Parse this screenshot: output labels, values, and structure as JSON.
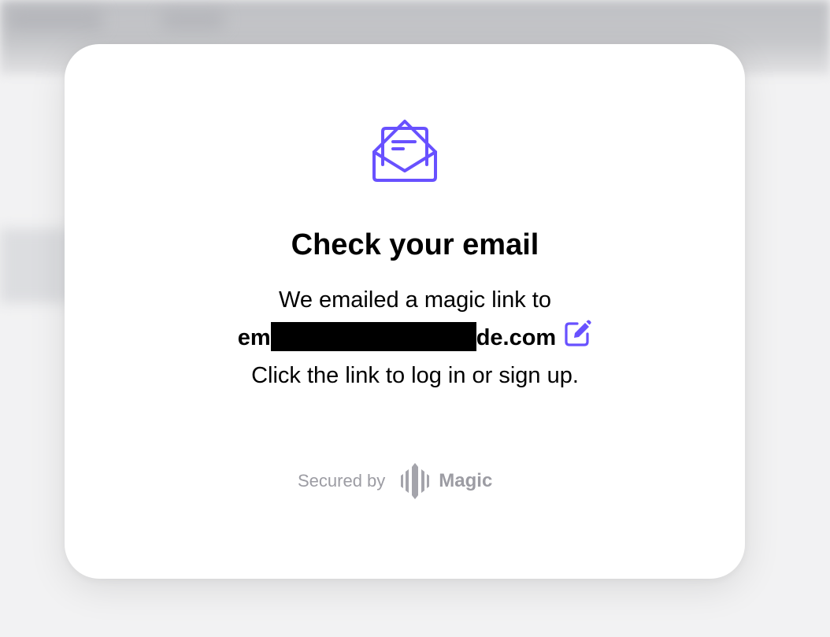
{
  "dialog": {
    "title": "Check your email",
    "intro": "We emailed a magic link to",
    "email_prefix": "em",
    "email_suffix": "de.com",
    "instructions": "Click the link to log in or sign up."
  },
  "icons": {
    "header": "open-envelope-icon",
    "edit": "edit-pencil-icon",
    "brand": "magic-logo-icon"
  },
  "footer": {
    "secured_by": "Secured by",
    "brand": "Magic"
  },
  "colors": {
    "accent": "#6851ff",
    "footer_text": "#9c9ca3",
    "redaction": "#000000"
  }
}
